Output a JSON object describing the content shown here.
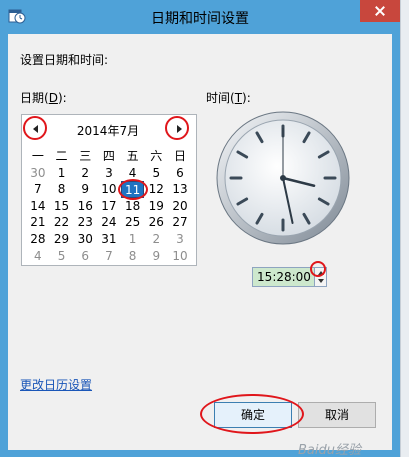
{
  "window": {
    "title": "日期和时间设置",
    "icon": "datetime-settings-icon"
  },
  "header": {
    "prompt": "设置日期和时间:"
  },
  "date": {
    "label_prefix": "日期(",
    "label_key": "D",
    "label_suffix": "):"
  },
  "time": {
    "label_prefix": "时间(",
    "label_key": "T",
    "label_suffix": "):",
    "value": "15:28:00"
  },
  "calendar": {
    "month_title": "2014年7月",
    "weekdays": [
      "一",
      "二",
      "三",
      "四",
      "五",
      "六",
      "日"
    ],
    "weeks": [
      [
        "30",
        "1",
        "2",
        "3",
        "4",
        "5",
        "6"
      ],
      [
        "7",
        "8",
        "9",
        "10",
        "11",
        "12",
        "13"
      ],
      [
        "14",
        "15",
        "16",
        "17",
        "18",
        "19",
        "20"
      ],
      [
        "21",
        "22",
        "23",
        "24",
        "25",
        "26",
        "27"
      ],
      [
        "28",
        "29",
        "30",
        "31",
        "1",
        "2",
        "3"
      ],
      [
        "4",
        "5",
        "6",
        "7",
        "8",
        "9",
        "10"
      ]
    ],
    "selected_day": "11"
  },
  "clock": {
    "hours": 15,
    "minutes": 28,
    "seconds": 0
  },
  "links": {
    "change_calendar": "更改日历设置"
  },
  "buttons": {
    "ok": "确定",
    "cancel": "取消"
  },
  "watermark": "Baidu经验",
  "colors": {
    "selected": "#1f73c2",
    "annotation": "#e0161b",
    "title_bar": "#4fa2d8",
    "link": "#1a56b8"
  }
}
